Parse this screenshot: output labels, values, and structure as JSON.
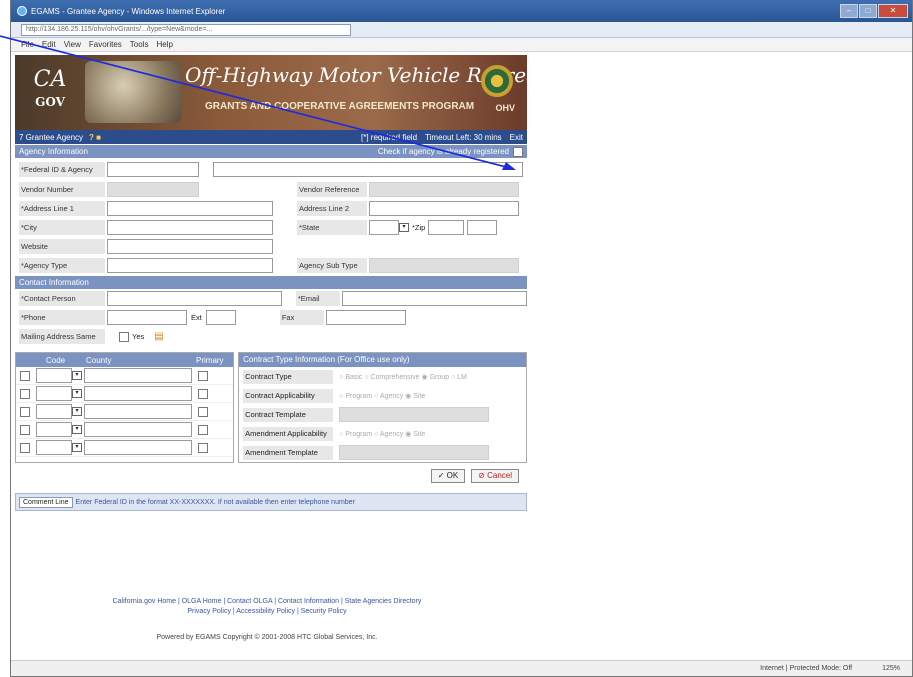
{
  "window": {
    "title": "EGAMS - Grantee Agency - Windows Internet Explorer",
    "url": "http://134.186.25.115/ohv/ohvGrants/.../type=New&mode=..."
  },
  "menu": [
    "File",
    "Edit",
    "View",
    "Favorites",
    "Tools",
    "Help"
  ],
  "banner": {
    "logo_top": "CA",
    "logo_bottom": "GOV",
    "title": "Off-Highway Motor Vehicle Recreation",
    "subtitle": "GRANTS AND COOPERATIVE AGREEMENTS PROGRAM",
    "badge": "OHV"
  },
  "appbar": {
    "left": "7 Grantee Agency",
    "help": "? ■",
    "required": "[*] required field",
    "timeout": "Timeout Left: 30 mins",
    "exit": "Exit"
  },
  "agency": {
    "header": "Agency Information",
    "check_label": "Check if agency is already registered",
    "federal_label": "*Federal ID & Agency Name",
    "vendor_num_label": "Vendor Number",
    "vendor_ref_label": "Vendor Reference",
    "addr1_label": "*Address Line 1",
    "addr2_label": "Address Line 2",
    "city_label": "*City",
    "state_label": "*State",
    "zip_label": "*Zip",
    "website_label": "Website",
    "type_label": "*Agency Type",
    "subtype_label": "Agency Sub Type"
  },
  "contact": {
    "header": "Contact Information",
    "person_label": "*Contact Person",
    "email_label": "*Email",
    "phone_label": "*Phone",
    "ext_label": "Ext",
    "fax_label": "Fax",
    "mailing_label": "Mailing Address Same",
    "yes_label": "Yes"
  },
  "grid": {
    "code": "Code",
    "county": "County",
    "primary": "Primary"
  },
  "ctype": {
    "header": "Contract Type Information (For Office use only)",
    "rows": [
      {
        "label": "Contract Type",
        "opts": "○ Basic  ○ Comprehensive  ◉ Group  ○ LM"
      },
      {
        "label": "Contract Applicability",
        "opts": "○ Program  ○ Agency  ◉ Site"
      },
      {
        "label": "Contract Template",
        "opts": ""
      },
      {
        "label": "Amendment Applicability",
        "opts": "○ Program  ○ Agency  ◉ Site"
      },
      {
        "label": "Amendment Template",
        "opts": ""
      }
    ]
  },
  "buttons": {
    "ok": "✓ OK",
    "cancel": "⊘ Cancel"
  },
  "comment": {
    "label": "Comment Line",
    "text": "Enter Federal ID in the format XX-XXXXXXX. If not available then enter telephone number"
  },
  "footer": {
    "links": "California.gov Home | OLGA Home | Contact OLGA | Contact Information | State Agencies Directory",
    "links2": "Privacy Policy | Accessibility Policy | Security Policy",
    "powered": "Powered by EGAMS Copyright © 2001-2008 HTC Global Services, Inc."
  },
  "status": {
    "zone": "Internet | Protected Mode: Off",
    "zoom": "125%"
  }
}
